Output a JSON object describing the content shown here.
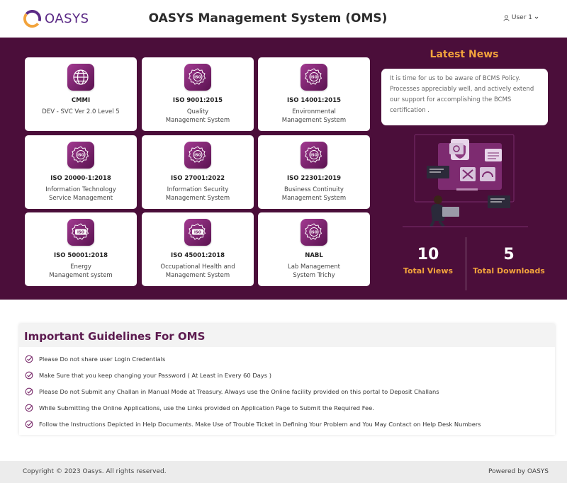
{
  "header": {
    "logo_text": "OASYS",
    "title": "OASYS Management System (OMS)",
    "user_label": "User 1"
  },
  "cards": [
    {
      "title": "CMMI",
      "subtitle_1": "DEV - SVC Ver 2.0 Level 5",
      "subtitle_2": "",
      "icon": "globe-icon"
    },
    {
      "title": "ISO 9001:2015",
      "subtitle_1": "Quality",
      "subtitle_2": "Management System",
      "icon": "iso-badge-icon"
    },
    {
      "title": "ISO 14001:2015",
      "subtitle_1": "Environmental",
      "subtitle_2": "Management System",
      "icon": "iso-badge-icon"
    },
    {
      "title": "ISO 20000-1:2018",
      "subtitle_1": "Information Technology",
      "subtitle_2": "Service Management",
      "icon": "iso-badge-icon"
    },
    {
      "title": "ISO 27001:2022",
      "subtitle_1": "Information Security",
      "subtitle_2": "Management System",
      "icon": "iso-badge-icon"
    },
    {
      "title": "ISO 22301:2019",
      "subtitle_1": "Business Continuity",
      "subtitle_2": "Management System",
      "icon": "iso-badge-icon"
    },
    {
      "title": "ISO 50001:2018",
      "subtitle_1": "Energy",
      "subtitle_2": "Management system",
      "icon": "iso-label-icon"
    },
    {
      "title": "ISO 45001:2018",
      "subtitle_1": "Occupational Health and",
      "subtitle_2": "Management System",
      "icon": "iso-label-icon"
    },
    {
      "title": "NABL",
      "subtitle_1": "Lab Management",
      "subtitle_2": "System Trichy",
      "icon": "iso-badge-icon"
    }
  ],
  "news": {
    "heading": "Latest News",
    "text": "It is time for us to be aware of BCMS Policy. Processes appreciably well, and actively extend our support for accomplishing the BCMS certification ."
  },
  "stats": {
    "views_value": "10",
    "views_label": "Total Views",
    "downloads_value": "5",
    "downloads_label": "Total Downloads"
  },
  "guidelines": {
    "heading": "Important Guidelines For OMS",
    "items": [
      "Please Do not share user Login Credentials",
      "Make Sure that you keep changing your Password ( At Least in Every 60 Days )",
      "Please Do not Submit any Challan in Manual Mode at Treasury. Always use the Online facility provided on this portal to Deposit Challans",
      "While Submitting the Online Applications, use the Links provided on Application Page to Submit the Required Fee.",
      "Follow the Instructions Depicted in Help Documents. Make Use of Trouble Ticket in Defining Your Problem and You May Contact on Help Desk Numbers"
    ]
  },
  "footer": {
    "copyright": "Copyright © 2023 Oasys. All rights reserved.",
    "powered": "Powered by OASYS"
  },
  "colors": {
    "hero_bg": "#4b0e3a",
    "accent_orange": "#f2a33c",
    "brand_purple": "#5b2a86"
  }
}
